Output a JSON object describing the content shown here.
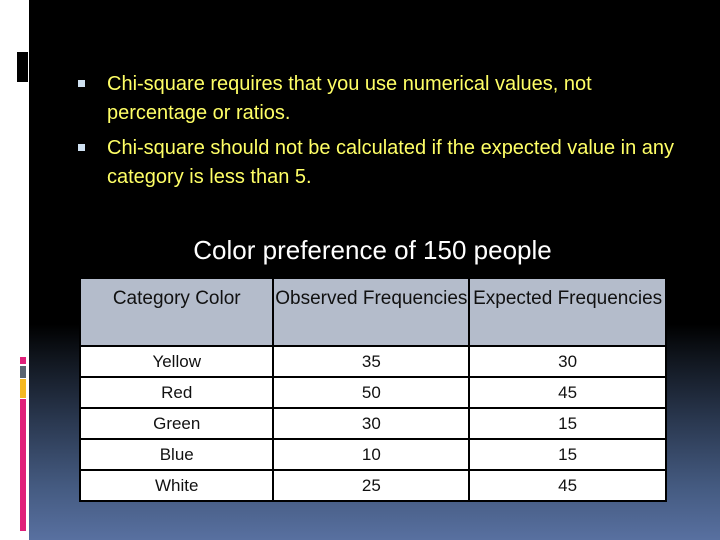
{
  "bullets": [
    "Chi-square requires that you use numerical values, not percentage or ratios.",
    "Chi-square should not be calculated if the expected value in any category is less than 5."
  ],
  "table_title": "Color preference of 150 people",
  "table": {
    "headers": [
      "Category  Color",
      "Observed Frequencies",
      "Expected Frequencies"
    ],
    "rows": [
      [
        "Yellow",
        "35",
        "30"
      ],
      [
        "Red",
        "50",
        "45"
      ],
      [
        "Green",
        "30",
        "15"
      ],
      [
        "Blue",
        "10",
        "15"
      ],
      [
        "White",
        "25",
        "45"
      ]
    ]
  },
  "colors": {
    "bullet_text": "#ffff66",
    "header_bg": "#b4bccb",
    "accent_pink": "#e0207a",
    "accent_gray": "#5a6470",
    "accent_yellow": "#f5b820"
  }
}
